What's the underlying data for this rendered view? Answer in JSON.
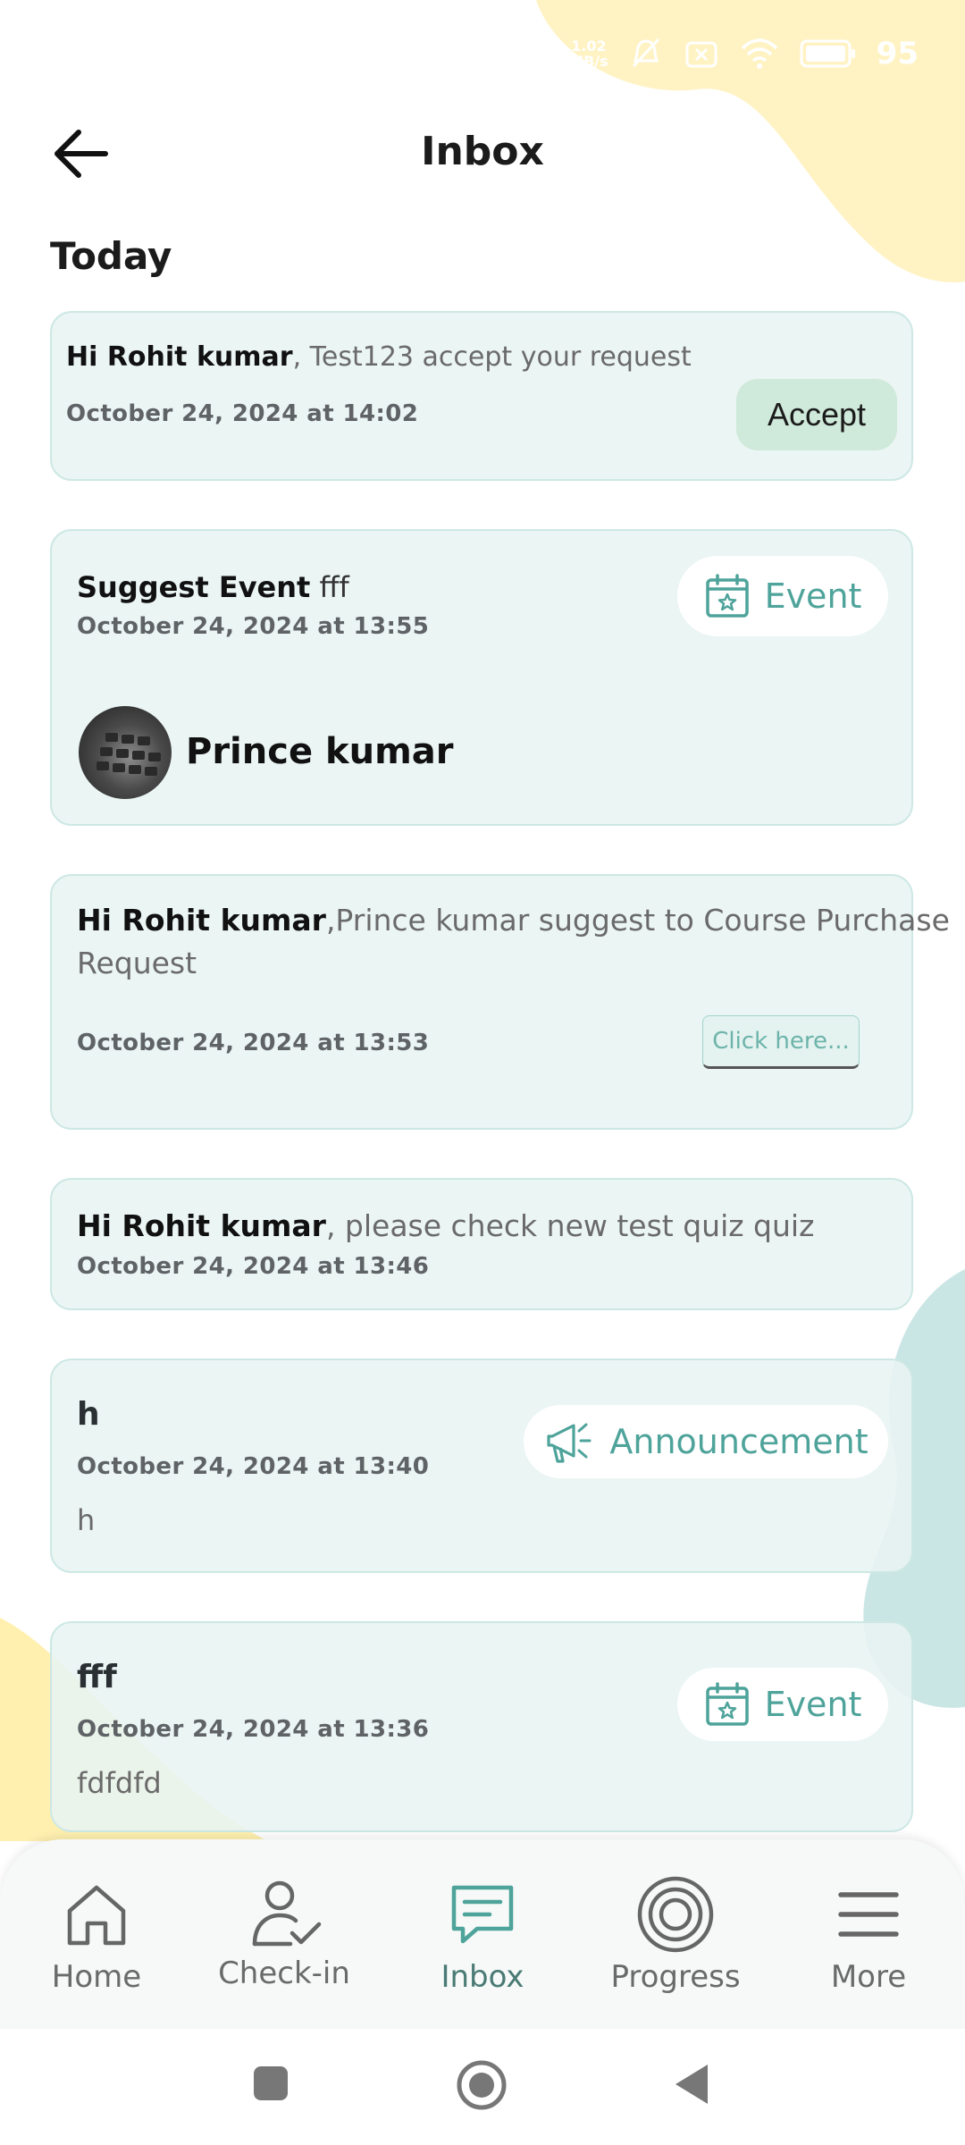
{
  "status_bar": {
    "speed_value": "1.02",
    "speed_unit": "MB/s",
    "battery": "95",
    "icons": [
      "mute-icon",
      "no-sim-icon",
      "wifi-icon",
      "battery-icon"
    ]
  },
  "header": {
    "title": "Inbox",
    "back_icon": "arrow-left-icon"
  },
  "section_title": "Today",
  "cards": {
    "accept": {
      "greeting": "Hi Rohit kumar",
      "message": ", Test123 accept your request",
      "date": "October 24, 2024 at 14:02",
      "button": "Accept"
    },
    "suggest_event": {
      "heading": "Suggest Event",
      "name": " fff",
      "date": "October 24, 2024 at 13:55",
      "tag": "Event",
      "person": "Prince kumar"
    },
    "course": {
      "greeting": "Hi Rohit kumar",
      "message_line1": ",Prince kumar suggest to  Course Purchase",
      "message_line2": "Request",
      "date": "October 24, 2024 at 13:53",
      "button": "Click here..."
    },
    "quiz": {
      "greeting": "Hi Rohit kumar",
      "message": ", please check new test quiz quiz",
      "date": "October 24, 2024 at 13:46"
    },
    "announcement": {
      "title": "h",
      "date": "October 24, 2024 at 13:40",
      "body": "h",
      "tag": "Announcement"
    },
    "event_fff": {
      "title": "fff",
      "date": "October 24, 2024 at 13:36",
      "body": "fdfdfd",
      "tag": "Event"
    }
  },
  "nav": {
    "items": [
      {
        "label": "Home",
        "icon": "home-icon"
      },
      {
        "label": "Check-in",
        "icon": "check-in-icon"
      },
      {
        "label": "Inbox",
        "icon": "chat-icon",
        "active": true
      },
      {
        "label": "Progress",
        "icon": "target-icon"
      },
      {
        "label": "More",
        "icon": "menu-icon"
      }
    ]
  },
  "colors": {
    "accent": "#4ea39a",
    "card_bg": "#e8f4f2",
    "accept_bg": "#cfe9da",
    "blob_yellow": "#fff3c4",
    "blob_teal": "#c9e6e5"
  }
}
